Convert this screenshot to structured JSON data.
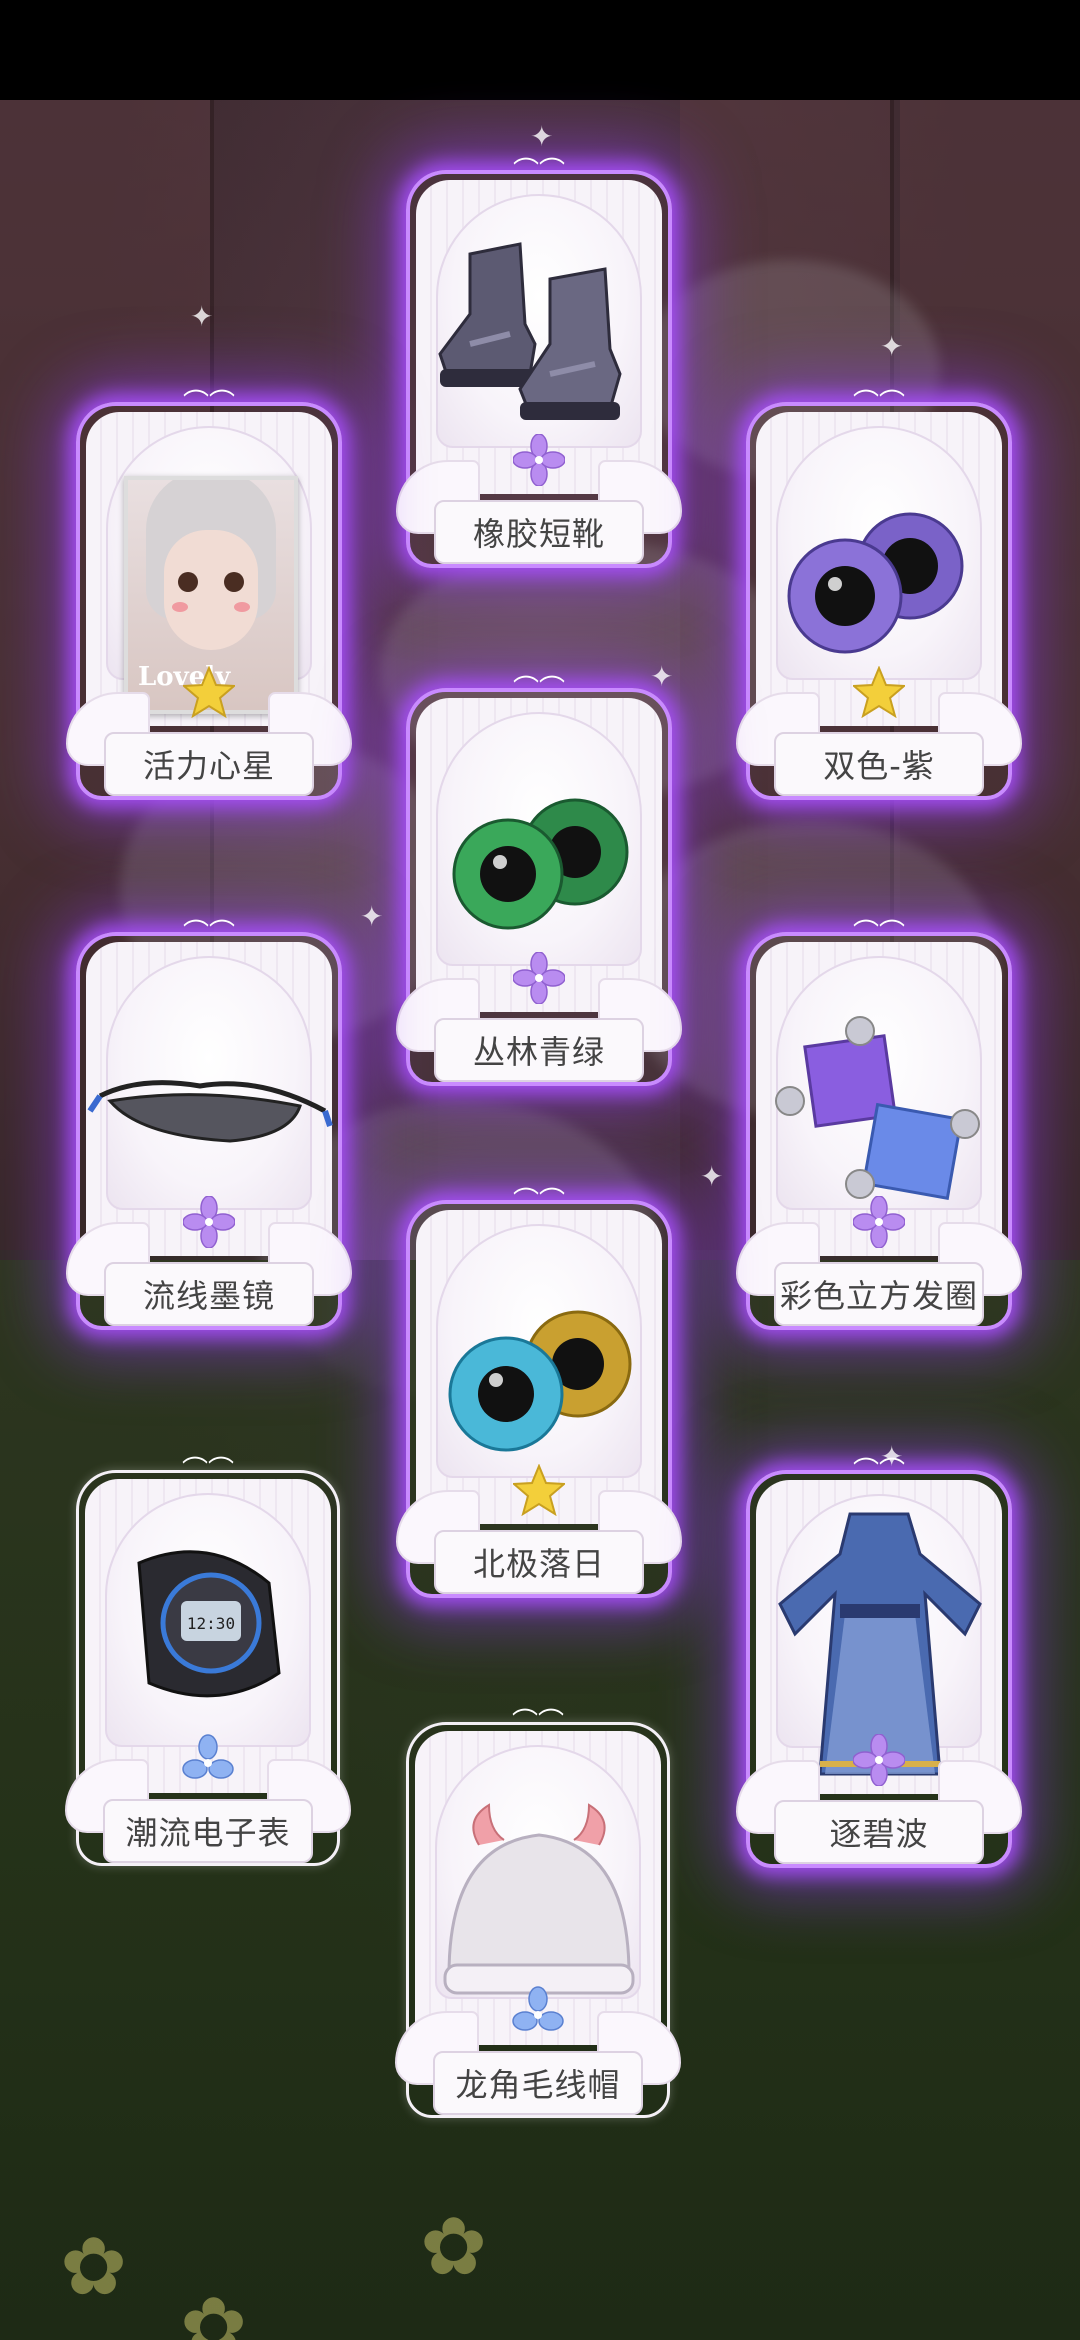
{
  "items": [
    {
      "name": "橡胶短靴",
      "rarity": "purple-flower",
      "glow": true,
      "icon": "boots-icon"
    },
    {
      "name": "活力心星",
      "rarity": "gold-star",
      "glow": true,
      "icon": "portrait-card-icon",
      "portrait_text": "Lovely"
    },
    {
      "name": "双色-紫",
      "rarity": "gold-star",
      "glow": true,
      "icon": "purple-eyes-icon"
    },
    {
      "name": "丛林青绿",
      "rarity": "purple-flower",
      "glow": true,
      "icon": "green-eyes-icon"
    },
    {
      "name": "流线墨镜",
      "rarity": "purple-flower",
      "glow": true,
      "icon": "sunglasses-icon"
    },
    {
      "name": "彩色立方发圈",
      "rarity": "purple-flower",
      "glow": true,
      "icon": "cube-hair-tie-icon"
    },
    {
      "name": "北极落日",
      "rarity": "gold-star",
      "glow": true,
      "icon": "heterochromia-eyes-icon"
    },
    {
      "name": "潮流电子表",
      "rarity": "blue-flower",
      "glow": false,
      "icon": "digital-watch-icon",
      "watch_text": "12:30"
    },
    {
      "name": "逐碧波",
      "rarity": "purple-flower",
      "glow": true,
      "icon": "blue-robe-icon"
    },
    {
      "name": "龙角毛线帽",
      "rarity": "blue-flower",
      "glow": false,
      "icon": "knit-hat-icon"
    }
  ],
  "colors": {
    "glow_purple": "#b060ff",
    "gold": "#f3cf3a",
    "purple_flower": "#b98cf0",
    "blue_flower": "#8fb2f2"
  }
}
